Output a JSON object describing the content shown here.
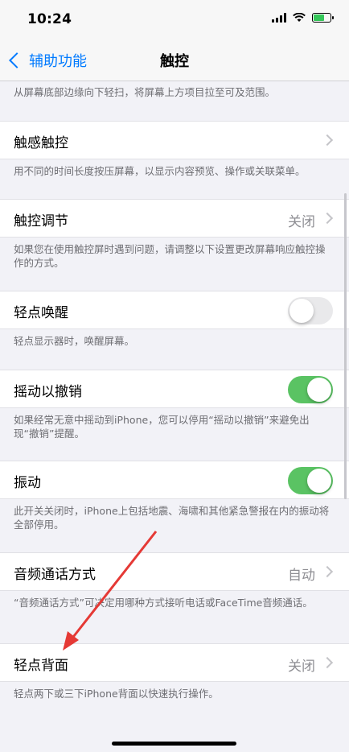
{
  "status_bar": {
    "time": "10:24"
  },
  "nav": {
    "back_label": "辅助功能",
    "title": "触控"
  },
  "sections": {
    "top_footer": "从屏幕底部边缘向下轻扫，将屏幕上方项目拉至可及范围。",
    "haptic_touch": {
      "label": "触感触控",
      "footer": "用不同的时间长度按压屏幕，以显示内容预览、操作或关联菜单。"
    },
    "touch_accommodations": {
      "label": "触控调节",
      "value": "关闭",
      "footer": "如果您在使用触控屏时遇到问题，请调整以下设置更改屏幕响应触控操作的方式。"
    },
    "tap_to_wake": {
      "label": "轻点唤醒",
      "state": "off",
      "footer": "轻点显示器时，唤醒屏幕。"
    },
    "shake_to_undo": {
      "label": "摇动以撤销",
      "state": "on",
      "footer": "如果经常无意中摇动到iPhone，您可以停用“摇动以撤销”来避免出现“撤销”提醒。"
    },
    "vibration": {
      "label": "振动",
      "state": "on",
      "footer": "此开关关闭时，iPhone上包括地震、海啸和其他紧急警报在内的振动将全部停用。"
    },
    "call_audio_routing": {
      "label": "音频通话方式",
      "value": "自动",
      "footer": "“音频通话方式”可决定用哪种方式接听电话或FaceTime音频通话。"
    },
    "back_tap": {
      "label": "轻点背面",
      "value": "关闭",
      "footer": "轻点两下或三下iPhone背面以快速执行操作。"
    }
  },
  "colors": {
    "accent": "#007aff",
    "toggle_on": "#5ac363",
    "annotation_arrow": "#e53935"
  }
}
